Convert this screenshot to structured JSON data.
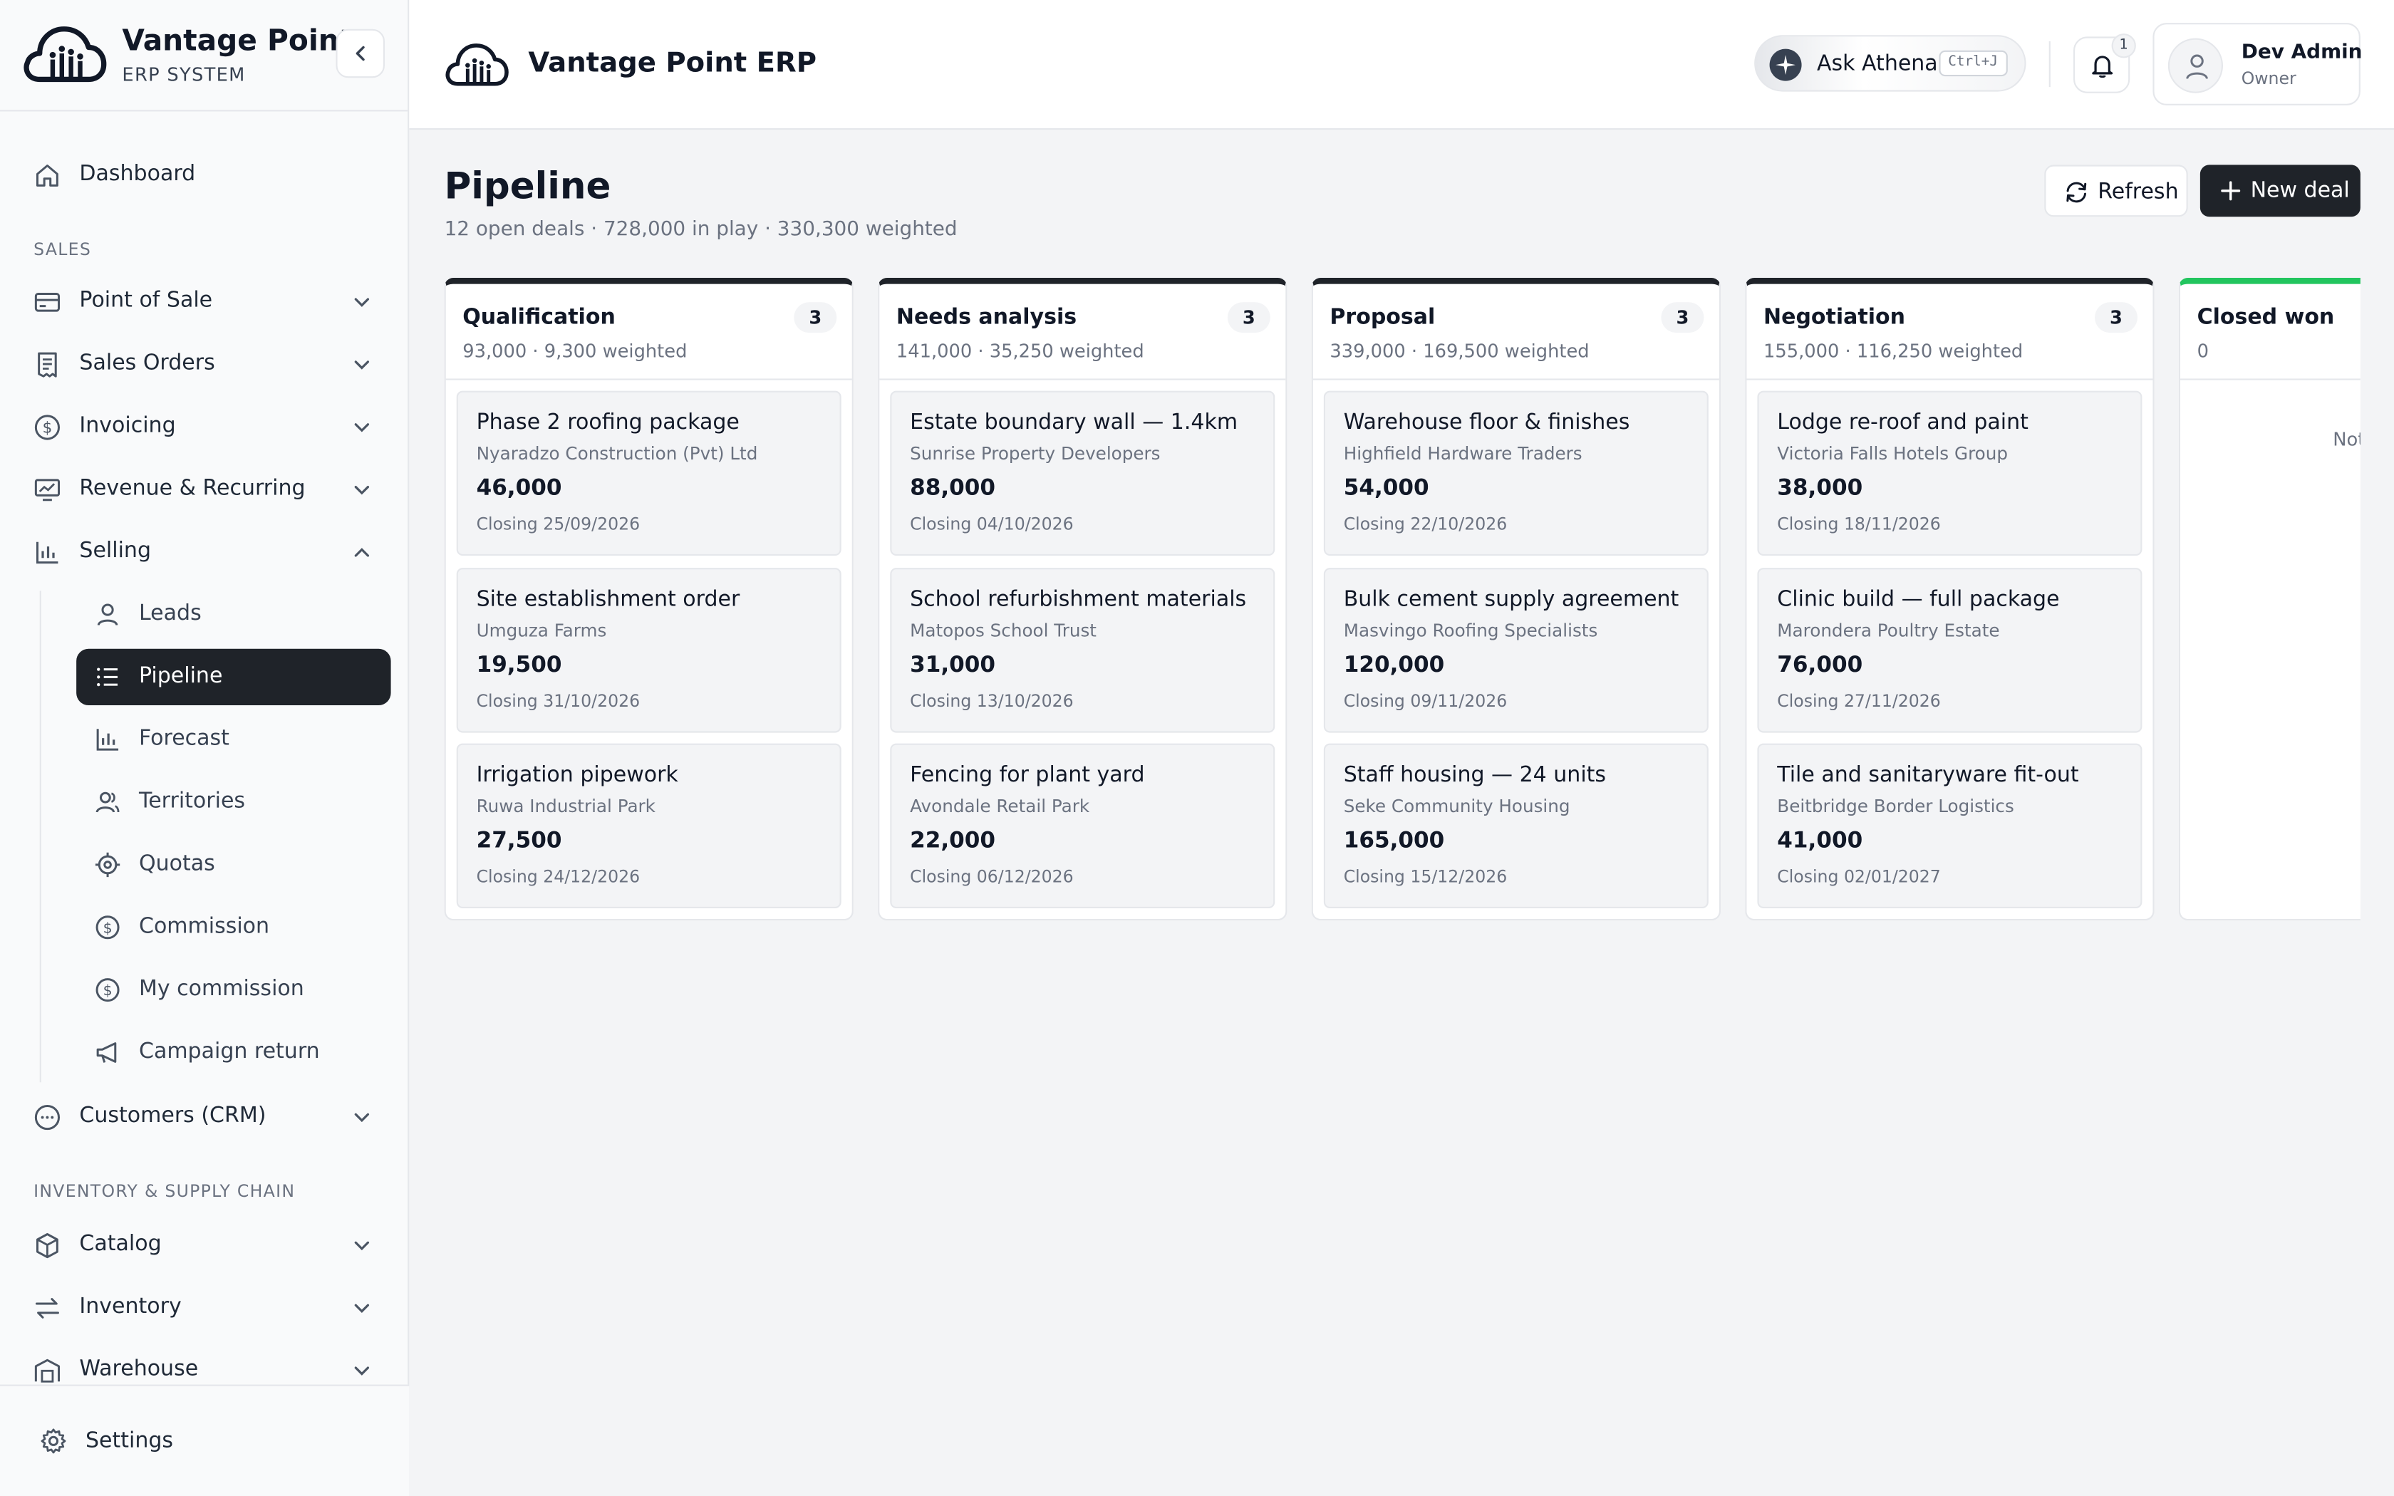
{
  "brand": {
    "name": "Vantage Point",
    "subtitle": "ERP SYSTEM"
  },
  "header": {
    "title": "Vantage Point ERP",
    "ask": {
      "label": "Ask Athena",
      "shortcut": "Ctrl+J"
    },
    "notifications": {
      "count": "1"
    },
    "user": {
      "name": "Dev Admin",
      "role": "Owner"
    }
  },
  "sidebar": {
    "dashboard": "Dashboard",
    "section_sales": "SALES",
    "sales": [
      {
        "label": "Point of Sale",
        "icon": "card-icon"
      },
      {
        "label": "Sales Orders",
        "icon": "receipt-icon"
      },
      {
        "label": "Invoicing",
        "icon": "dollar-icon"
      },
      {
        "label": "Revenue & Recurring",
        "icon": "trend-icon"
      },
      {
        "label": "Selling",
        "icon": "bar-chart-icon",
        "expanded": true
      }
    ],
    "selling_sub": [
      {
        "label": "Leads",
        "icon": "user-icon"
      },
      {
        "label": "Pipeline",
        "icon": "list-icon",
        "active": true
      },
      {
        "label": "Forecast",
        "icon": "bar-chart-icon"
      },
      {
        "label": "Territories",
        "icon": "users-icon"
      },
      {
        "label": "Quotas",
        "icon": "target-icon"
      },
      {
        "label": "Commission",
        "icon": "dollar-icon"
      },
      {
        "label": "My commission",
        "icon": "dollar-icon"
      },
      {
        "label": "Campaign return",
        "icon": "megaphone-icon"
      }
    ],
    "crm": "Customers (CRM)",
    "section_inventory": "INVENTORY & SUPPLY CHAIN",
    "inventory": [
      {
        "label": "Catalog",
        "icon": "box-icon"
      },
      {
        "label": "Inventory",
        "icon": "transfer-icon"
      },
      {
        "label": "Warehouse",
        "icon": "warehouse-icon"
      }
    ],
    "settings": "Settings"
  },
  "page": {
    "title": "Pipeline",
    "summary": "12 open deals · 728,000 in play · 330,300 weighted",
    "refresh_label": "Refresh",
    "new_deal_label": "New deal"
  },
  "columns": [
    {
      "name": "Qualification",
      "count": "3",
      "summary": "93,000 · 9,300 weighted",
      "deals": [
        {
          "title": "Phase 2 roofing package",
          "company": "Nyaradzo Construction (Pvt) Ltd",
          "amount": "46,000",
          "closing": "Closing 25/09/2026"
        },
        {
          "title": "Site establishment order",
          "company": "Umguza Farms",
          "amount": "19,500",
          "closing": "Closing 31/10/2026"
        },
        {
          "title": "Irrigation pipework",
          "company": "Ruwa Industrial Park",
          "amount": "27,500",
          "closing": "Closing 24/12/2026"
        }
      ]
    },
    {
      "name": "Needs analysis",
      "count": "3",
      "summary": "141,000 · 35,250 weighted",
      "deals": [
        {
          "title": "Estate boundary wall — 1.4km",
          "company": "Sunrise Property Developers",
          "amount": "88,000",
          "closing": "Closing 04/10/2026"
        },
        {
          "title": "School refurbishment materials",
          "company": "Matopos School Trust",
          "amount": "31,000",
          "closing": "Closing 13/10/2026"
        },
        {
          "title": "Fencing for plant yard",
          "company": "Avondale Retail Park",
          "amount": "22,000",
          "closing": "Closing 06/12/2026"
        }
      ]
    },
    {
      "name": "Proposal",
      "count": "3",
      "summary": "339,000 · 169,500 weighted",
      "deals": [
        {
          "title": "Warehouse floor & finishes",
          "company": "Highfield Hardware Traders",
          "amount": "54,000",
          "closing": "Closing 22/10/2026"
        },
        {
          "title": "Bulk cement supply agreement",
          "company": "Masvingo Roofing Specialists",
          "amount": "120,000",
          "closing": "Closing 09/11/2026"
        },
        {
          "title": "Staff housing — 24 units",
          "company": "Seke Community Housing",
          "amount": "165,000",
          "closing": "Closing 15/12/2026"
        }
      ]
    },
    {
      "name": "Negotiation",
      "count": "3",
      "summary": "155,000 · 116,250 weighted",
      "deals": [
        {
          "title": "Lodge re-roof and paint",
          "company": "Victoria Falls Hotels Group",
          "amount": "38,000",
          "closing": "Closing 18/11/2026"
        },
        {
          "title": "Clinic build — full package",
          "company": "Marondera Poultry Estate",
          "amount": "76,000",
          "closing": "Closing 27/11/2026"
        },
        {
          "title": "Tile and sanitaryware fit-out",
          "company": "Beitbridge Border Logistics",
          "amount": "41,000",
          "closing": "Closing 02/01/2027"
        }
      ]
    },
    {
      "name": "Closed won",
      "summary": "0",
      "empty": "Not",
      "accent": "#22c55e"
    }
  ]
}
